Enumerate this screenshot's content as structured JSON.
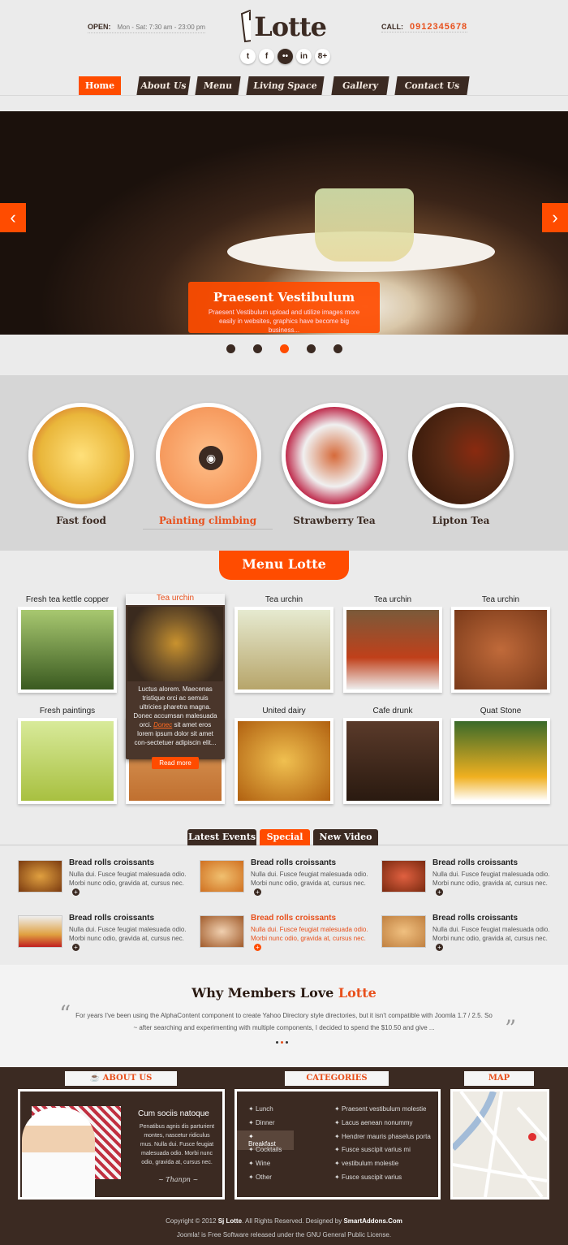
{
  "header": {
    "open_label": "OPEN:",
    "hours": "Mon - Sat: 7:30 am - 23:00 pm",
    "logo": "Lotte",
    "call_label": "CALL:",
    "phone": "0912345678",
    "social": [
      {
        "icon": "twitter-icon",
        "glyph": "t"
      },
      {
        "icon": "facebook-icon",
        "glyph": "f"
      },
      {
        "icon": "flickr-icon",
        "glyph": "••"
      },
      {
        "icon": "linkedin-icon",
        "glyph": "in"
      },
      {
        "icon": "google-plus-icon",
        "glyph": "8+"
      }
    ]
  },
  "nav": [
    "Home",
    "About Us",
    "Menu",
    "Living Space",
    "Gallery",
    "Contact Us"
  ],
  "slider": {
    "title": "Praesent Vestibulum",
    "text": "Praesent Vestibulum upload and utilize images more easily in websites, graphics have become big business...",
    "active_slide": 3,
    "slide_count": 5
  },
  "circles": [
    "Fast food",
    "Painting climbing",
    "Strawberry Tea",
    "Lipton Tea"
  ],
  "menu_title": "Menu Lotte",
  "menu_items": [
    "Fresh tea kettle copper",
    "Tea urchin",
    "Tea urchin",
    "Tea urchin",
    "Tea urchin",
    "Fresh paintings",
    "",
    "United dairy",
    "Cafe drunk",
    "Quat Stone"
  ],
  "menu_hover": {
    "title": "Tea urchin",
    "text1": "Luctus alorem. Maecenas tristique orci ac semuis ultricies pharetra magna. Donec accumsan malesuada orci.",
    "link": "Donec",
    "text2": " sit amet eros lorem ipsum dolor sit amet con-sectetuer adipiscin elit...",
    "button": "Read more"
  },
  "tabs": [
    "Latest Events",
    "Special",
    "New Video"
  ],
  "events": {
    "title": "Bread rolls croissants",
    "text": "Nulla dui. Fusce feugiat malesuada odio. Morbi nunc odio, gravida at, cursus nec."
  },
  "testimonial": {
    "heading": "Why Members Love",
    "brand": "Lotte",
    "quote": "For years I've been using the AlphaContent component to create Yahoo Directory style directories, but it isn't compatible with Joomla 1.7 / 2.5. So ~ after searching and experimenting with multiple components, I decided to spend the $10.50 and give ...",
    "open_quote": "“",
    "close_quote": "”"
  },
  "footer": {
    "about_title": "ABOUT US",
    "categories_title": "CATEGORIES",
    "map_title": "MAP",
    "about_heading": "Cum sociis natoque",
    "about_text": "Penatibus agnis dis parturient montes, nascetur ridiculus mus. Nulla dui. Fusce feugiat malesuada odio. Morbi nunc odio, gravida at, cursus nec.",
    "signature": "~ Thanpn ~",
    "cat_left": [
      "Lunch",
      "Dinner",
      "Breakfast",
      "Cocktails",
      "Wine",
      "Other"
    ],
    "cat_right": [
      "Praesent vestibulum molestie",
      "Lacus aenean nonummy",
      "Hendrer mauris phaselus porta",
      "Fusce suscipit varius mi",
      "vestibulum molestie",
      "Fusce suscipit varius"
    ],
    "copy1a": "Copyright © 2012 ",
    "copy1b": "Sj Lotte",
    "copy1c": ". All Rights Reserved. Designed by ",
    "copy1d": "SmartAddons.Com",
    "copy2": "Joomla! is Free Software released under the GNU General Public License."
  },
  "colors": {
    "accent": "#ff4c00",
    "brown": "#3b2a22"
  }
}
